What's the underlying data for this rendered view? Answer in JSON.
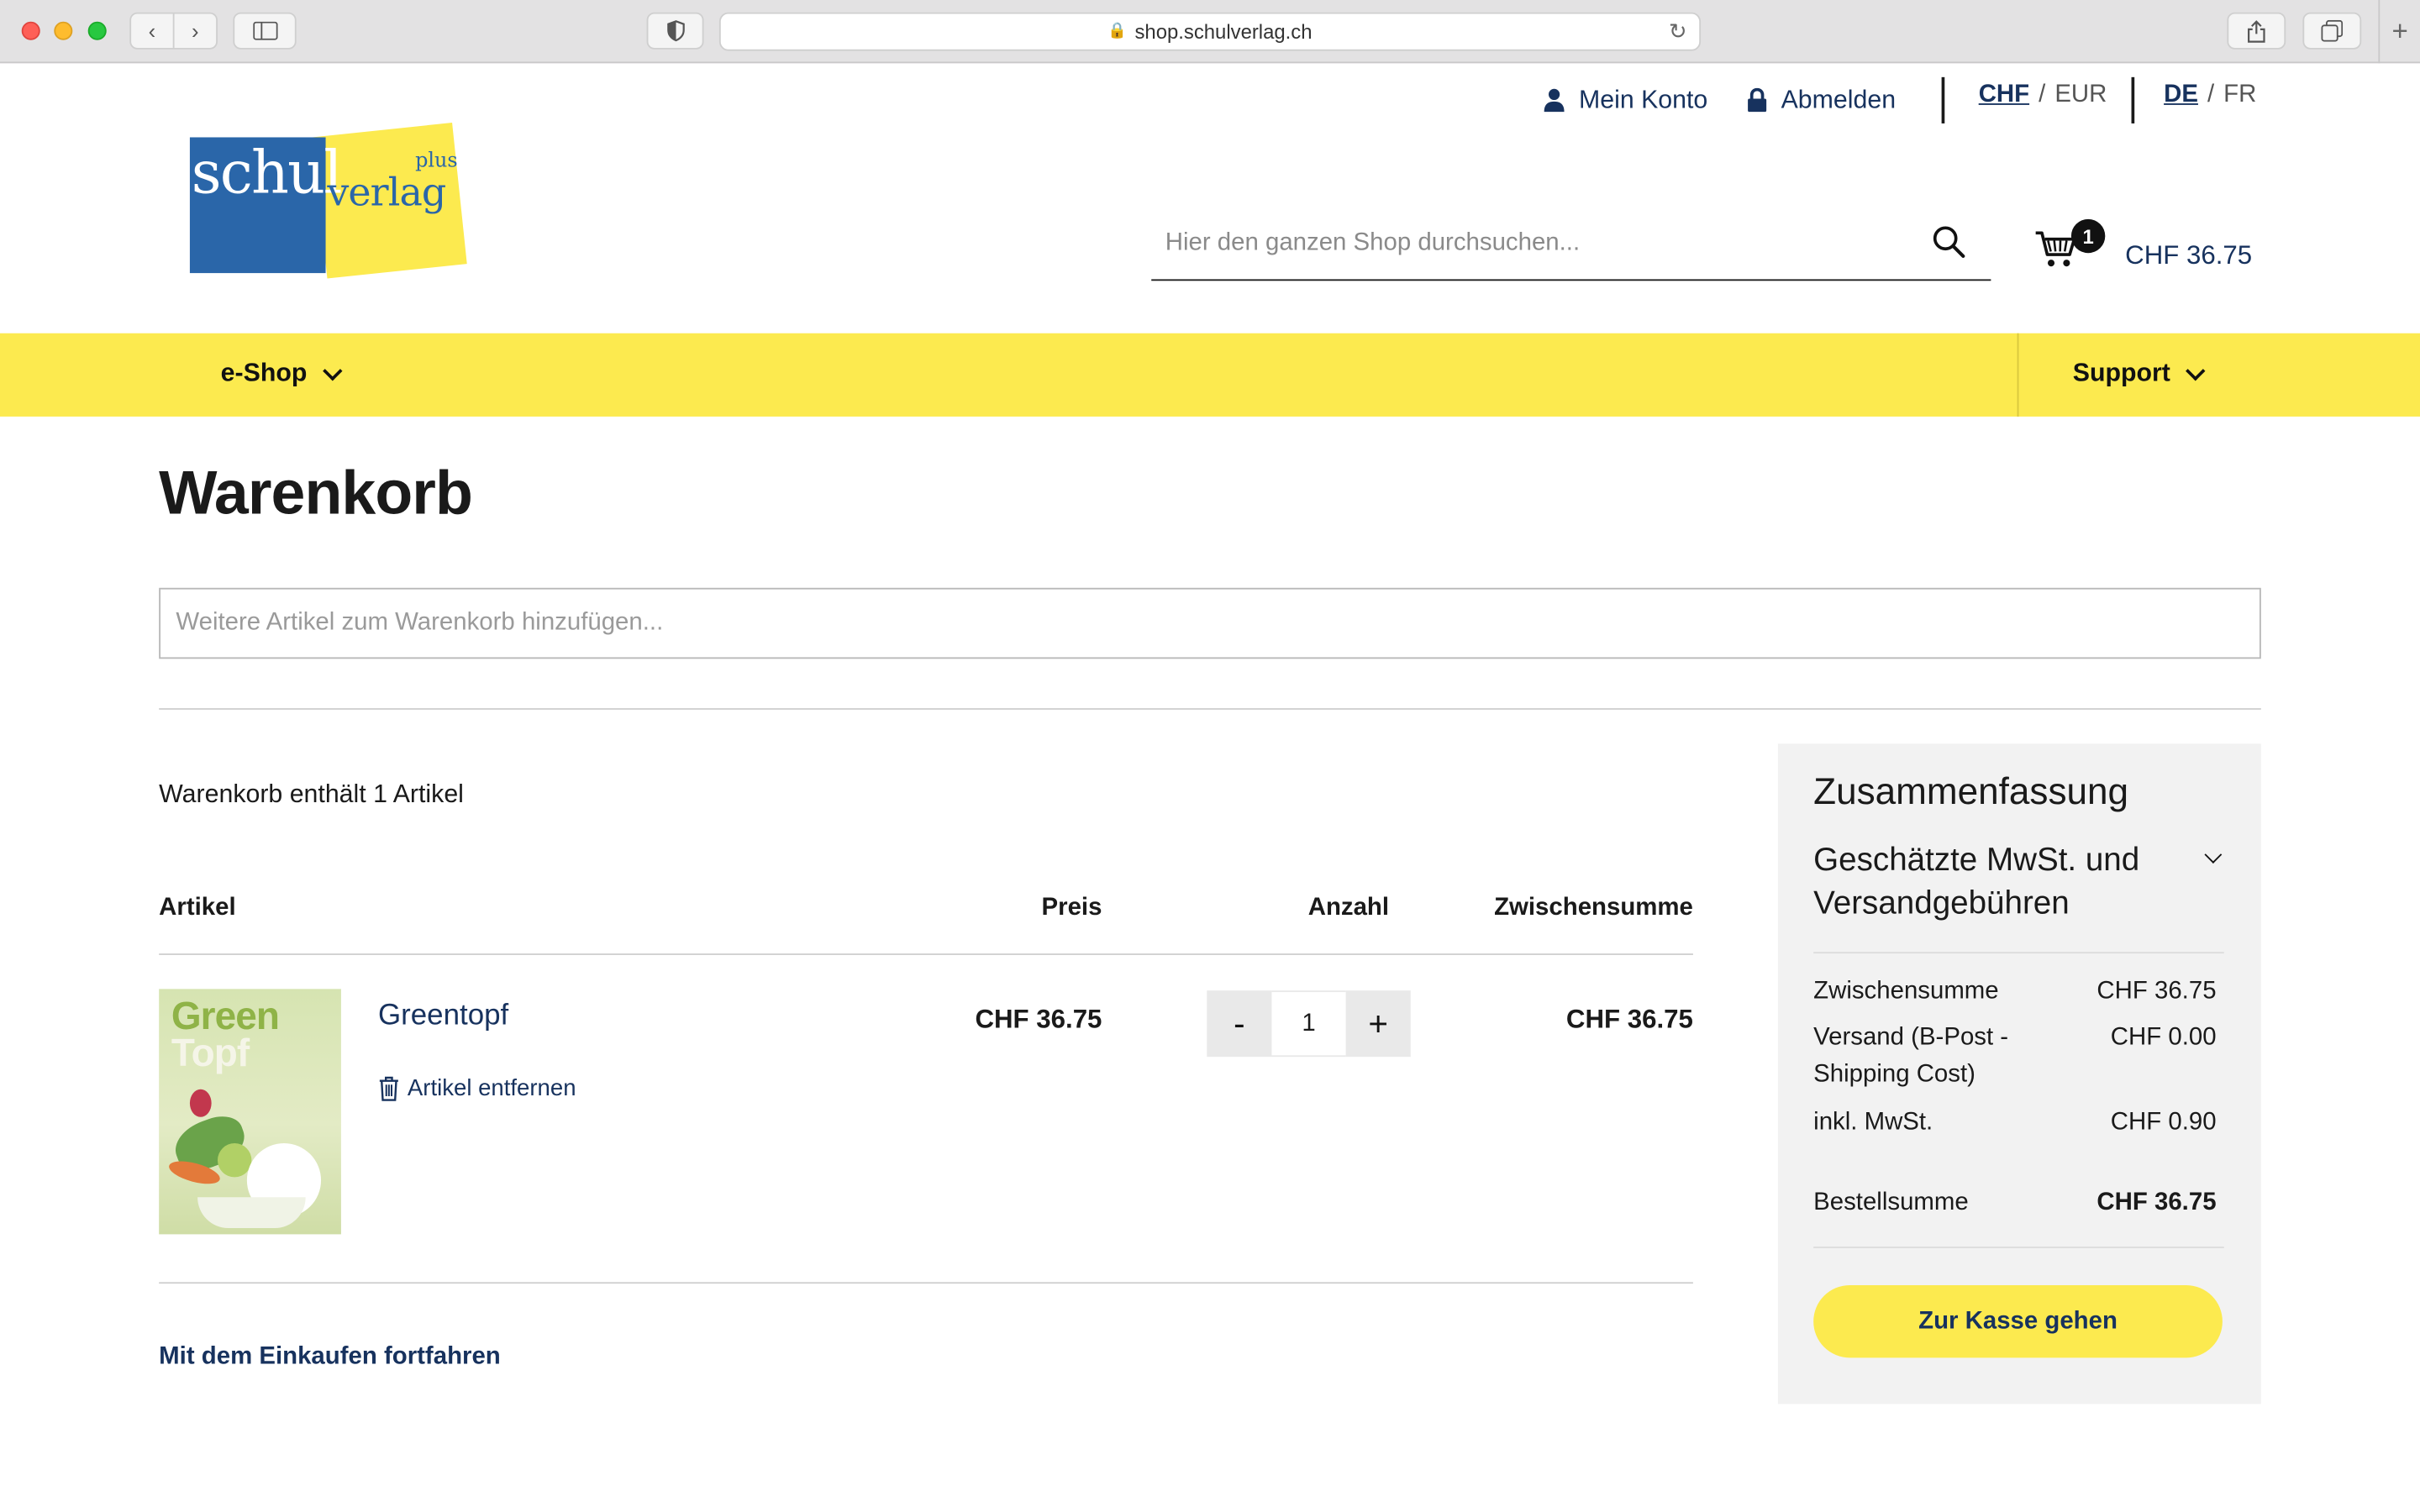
{
  "browser": {
    "url": "shop.schulverlag.ch"
  },
  "header": {
    "account_label": "Mein Konto",
    "logout_label": "Abmelden",
    "currencies": [
      {
        "code": "CHF",
        "active": true
      },
      {
        "code": "EUR",
        "active": false
      }
    ],
    "languages": [
      {
        "code": "DE",
        "active": true
      },
      {
        "code": "FR",
        "active": false
      }
    ],
    "logo": {
      "word1": "schul",
      "word2": "verlag",
      "word3": "plus"
    },
    "search": {
      "placeholder": "Hier den ganzen Shop durchsuchen..."
    },
    "minicart": {
      "count": "1",
      "amount": "CHF 36.75"
    }
  },
  "nav": {
    "eshop_label": "e-Shop",
    "support_label": "Support"
  },
  "cart": {
    "title": "Warenkorb",
    "quickadd_placeholder": "Weitere Artikel zum Warenkorb hinzufügen...",
    "count_text": "Warenkorb enthält 1 Artikel",
    "columns": {
      "artikel": "Artikel",
      "preis": "Preis",
      "anzahl": "Anzahl",
      "zwischensumme": "Zwischensumme"
    },
    "items": [
      {
        "name": "Greentopf",
        "cover_word1": "Green",
        "cover_word2": "Topf",
        "remove_label": "Artikel entfernen",
        "price": "CHF 36.75",
        "qty": "1",
        "qty_minus": "-",
        "qty_plus": "+",
        "subtotal": "CHF 36.75"
      }
    ],
    "continue_label": "Mit dem Einkaufen fortfahren"
  },
  "summary": {
    "title": "Zusammenfassung",
    "estimate_label": "Geschätzte MwSt. und Versandgebühren",
    "rows": [
      {
        "label": "Zwischensumme",
        "value": "CHF 36.75"
      },
      {
        "label": "Versand (B-Post - Shipping Cost)",
        "value": "CHF 0.00"
      },
      {
        "label": "inkl. MwSt.",
        "value": "CHF 0.90"
      },
      {
        "label": "Bestellsumme",
        "value": "CHF 36.75"
      }
    ],
    "checkout_label": "Zur Kasse gehen"
  },
  "colors": {
    "brand_yellow": "#fcea4f",
    "brand_blue": "#2a66a9",
    "link_navy": "#17325e"
  }
}
